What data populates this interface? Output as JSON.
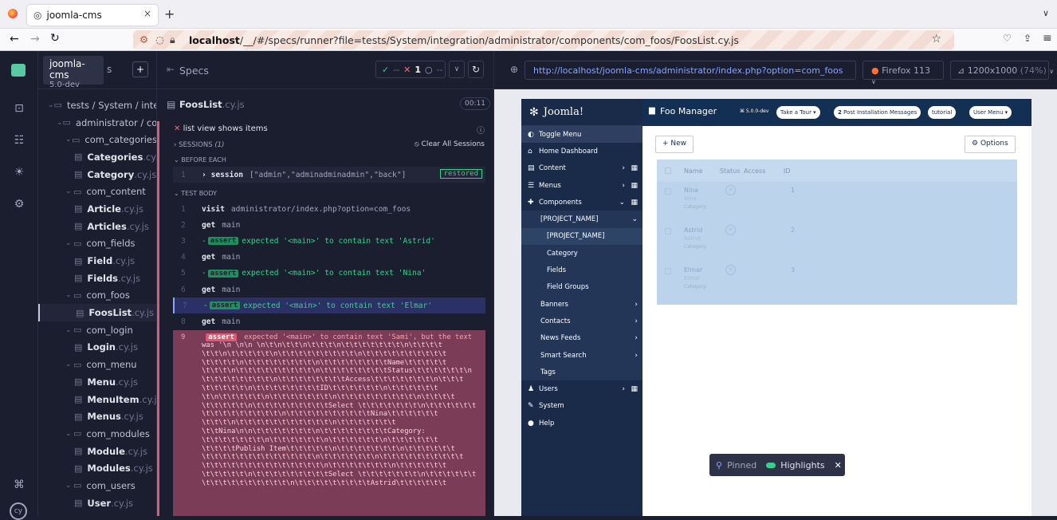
{
  "browser": {
    "tab_title": "joomla-cms",
    "tab_close": "×",
    "new_tab": "+",
    "url_host": "localhost",
    "url_path": "/__/#/specs/runner?file=tests/System/integration/administrator/components/com_foos/FoosList.cy.js"
  },
  "project": {
    "name": "joomla-cms",
    "version": "5.0-dev",
    "specs_suffix": "s"
  },
  "specs_panel": {
    "title": "Specs",
    "passed": "--",
    "failed": "1",
    "pending": "--",
    "tree": [
      {
        "type": "folder",
        "label": "tests / System / inte",
        "level": 0
      },
      {
        "type": "folder",
        "label": "administrator / co",
        "level": 1
      },
      {
        "type": "folder",
        "label": "com_categories",
        "level": 2
      },
      {
        "type": "file",
        "name": "Categories",
        "ext": ".cy.js",
        "level": 3
      },
      {
        "type": "file",
        "name": "Category",
        "ext": ".cy.js",
        "level": 3
      },
      {
        "type": "folder",
        "label": "com_content",
        "level": 2
      },
      {
        "type": "file",
        "name": "Article",
        "ext": ".cy.js",
        "level": 3
      },
      {
        "type": "file",
        "name": "Articles",
        "ext": ".cy.js",
        "level": 3
      },
      {
        "type": "folder",
        "label": "com_fields",
        "level": 2
      },
      {
        "type": "file",
        "name": "Field",
        "ext": ".cy.js",
        "level": 3
      },
      {
        "type": "file",
        "name": "Fields",
        "ext": ".cy.js",
        "level": 3
      },
      {
        "type": "folder",
        "label": "com_foos",
        "level": 2
      },
      {
        "type": "file",
        "name": "FoosList",
        "ext": ".cy.js",
        "level": 3,
        "selected": true
      },
      {
        "type": "folder",
        "label": "com_login",
        "level": 2
      },
      {
        "type": "file",
        "name": "Login",
        "ext": ".cy.js",
        "level": 3
      },
      {
        "type": "folder",
        "label": "com_menu",
        "level": 2
      },
      {
        "type": "file",
        "name": "Menu",
        "ext": ".cy.js",
        "level": 3
      },
      {
        "type": "file",
        "name": "MenuItem",
        "ext": ".cy.js",
        "level": 3
      },
      {
        "type": "file",
        "name": "Menus",
        "ext": ".cy.js",
        "level": 3
      },
      {
        "type": "folder",
        "label": "com_modules",
        "level": 2
      },
      {
        "type": "file",
        "name": "Module",
        "ext": ".cy.js",
        "level": 3
      },
      {
        "type": "file",
        "name": "Modules",
        "ext": ".cy.js",
        "level": 3
      },
      {
        "type": "folder",
        "label": "com_users",
        "level": 2
      },
      {
        "type": "file",
        "name": "User",
        "ext": ".cy.js",
        "level": 3
      },
      {
        "type": "file",
        "name": "Users",
        "ext": ".cy.js",
        "level": 3
      }
    ]
  },
  "reporter": {
    "file_name": "FoosList",
    "file_ext": ".cy.js",
    "duration": "00:11",
    "test_title": "list view shows items",
    "sessions_label": "SESSIONS",
    "sessions_count": "(1)",
    "clear_sessions": "Clear All Sessions",
    "before_each": "BEFORE EACH",
    "test_body": "TEST BODY",
    "session_cmd": {
      "num": "1",
      "name": "session",
      "msg": "[\"admin\",\"adminadminadmin\",\"back\"]",
      "status": "restored"
    },
    "commands": [
      {
        "num": "1",
        "name": "visit",
        "msg": "administrator/index.php?option=com_foos"
      },
      {
        "num": "2",
        "name": "get",
        "msg": "main"
      },
      {
        "num": "3",
        "assert": "assert",
        "msg": "expected '<main>' to contain text 'Astrid'"
      },
      {
        "num": "4",
        "name": "get",
        "msg": "main"
      },
      {
        "num": "5",
        "assert": "assert",
        "msg": "expected '<main>' to contain text 'Nina'"
      },
      {
        "num": "6",
        "name": "get",
        "msg": "main"
      },
      {
        "num": "7",
        "assert": "assert",
        "msg": "expected '<main>' to contain text 'Elmar'",
        "pinned": true
      },
      {
        "num": "8",
        "name": "get",
        "msg": "main"
      }
    ],
    "failed": {
      "num": "9",
      "assert": "assert",
      "lines": [
        "expected '<main>' to contain text 'Sami', but the text",
        "was '\\n \\n\\n \\n\\t\\n\\t\\t\\n\\t\\t\\t\\n\\t\\t\\t\\t\\t\\t\\t\\n\\t\\t\\t\\t",
        "\\t\\t\\n\\t\\t\\t\\t\\t\\n\\t\\t\\t\\t\\t\\t\\t\\t\\t\\n\\t\\t\\t\\t\\t\\t\\t\\t\\t\\t",
        "\\t\\t\\t\\t\\n\\t\\t\\t\\t\\t\\t\\t\\t\\n\\t\\t\\t\\t\\t\\t\\t\\tName\\t\\t\\t\\t\\t",
        "\\t\\t\\t\\n\\t\\t\\t\\t\\t\\t\\t\\t\\t\\n\\t\\t\\t\\t\\t\\t\\t\\tStatus\\t\\t\\t\\t\\t\\t\\n",
        "\\t\\t\\t\\t\\t\\t\\t\\t\\n\\t\\t\\t\\t\\t\\t\\t\\tAccess\\t\\t\\t\\t\\t\\t\\t\\n\\t\\t\\t",
        "\\t\\t\\t\\t\\t\\n\\t\\t\\t\\t\\t\\t\\t\\tID\\t\\t\\t\\t\\t\\t\\n\\t\\t\\t\\t\\t\\t",
        "\\t\\n\\t\\t\\t\\t\\t\\n\\t\\t\\t\\t\\t\\t\\t\\n\\t\\t\\t\\t\\t\\t\\t\\t\\t\\n\\t\\t\\t\\t",
        "\\t\\t\\t\\t\\t\\n\\t\\t\\t\\t\\t\\t\\t\\t\\tSelect \\t\\t\\t\\t\\t\\t\\t\\n\\t\\t\\t\\t\\t\\t",
        "\\t\\t\\t\\t\\t\\t\\t\\t\\t\\n\\t\\t\\t\\t\\t\\t\\t\\t\\t\\tNina\\t\\t\\t\\t\\t\\t",
        "\\t\\t\\t\\n\\t\\t\\t\\t\\t\\t\\t\\t\\t\\t\\t\\n\\t\\t\\t\\t\\t\\t\\t",
        "\\t\\tNina\\n\\n\\t\\t\\t\\t\\t\\t\\t\\n\\t\\t\\t\\t\\t\\t\\t\\tCategory:",
        "\\t\\t\\t\\t\\t\\t\\t\\n\\t\\t\\t\\t\\t\\t\\n\\t\\t\\t\\t\\t\\t\\n\\t\\t\\t\\t\\t\\t",
        "\\t\\t\\t\\tPublish Item\\t\\t\\t\\t\\t\\n\\t\\t\\t\\t\\t\\t\\t\\n\\t\\t\\t\\t\\t\\t",
        "\\t\\t\\t\\t\\t\\t\\t\\t\\t\\t\\t\\t\\t\\n\\t\\t\\t\\t\\t\\t\\n\\t\\t\\t\\t\\t\\t\\t\\t\\t\\t",
        "\\t\\t\\t\\t\\t\\t\\t\\t\\t\\t\\t\\t\\t\\t\\n\\t\\t\\t\\t\\t\\t\\t\\n\\t\\t\\t\\t\\t\\t",
        "\\t\\t\\t\\t\\t\\n\\t\\t\\t\\t\\t\\t\\t\\t\\tSelect \\t\\t\\t\\t\\t\\t\\t\\n\\t\\t\\t\\t\\t\\t",
        "\\t\\t\\t\\t\\t\\t\\t\\t\\t\\t\\n\\t\\t\\t\\t\\t\\t\\t\\t\\tAstrid\\t\\t\\t\\t\\t\\t"
      ]
    }
  },
  "aut": {
    "url": "http://localhost/joomla-cms/administrator/index.php?option=com_foos",
    "browser": "Firefox 113",
    "viewport": "1200x1000",
    "scale": "(74%)"
  },
  "joomla": {
    "brand": "Joomla!",
    "page_title": "Foo Manager",
    "version": "5.0.0-dev",
    "take_tour": "Take a Tour",
    "notifications_count": "2",
    "post_install": "Post Installation Messages",
    "tutorial": "tutorial",
    "user_menu": "User Menu",
    "new_button": "New",
    "options_button": "Options",
    "menu": [
      {
        "label": "Toggle Menu",
        "icon": "toggle-icon",
        "highlight": true
      },
      {
        "label": "Home Dashboard",
        "icon": "home-icon"
      },
      {
        "label": "Content",
        "icon": "file-icon",
        "arrow": true,
        "grid": true
      },
      {
        "label": "Menus",
        "icon": "list-icon",
        "arrow": true,
        "grid": true
      },
      {
        "label": "Components",
        "icon": "puzzle-icon",
        "arrow": "down",
        "grid": true
      },
      {
        "label": "[PROJECT_NAME]",
        "sub": 1,
        "arrow": "down"
      },
      {
        "label": "[PROJECT_NAME]",
        "sub": 2,
        "active": true
      },
      {
        "label": "Category",
        "sub": 2
      },
      {
        "label": "Fields",
        "sub": 2
      },
      {
        "label": "Field Groups",
        "sub": 2
      },
      {
        "label": "Banners",
        "sub": 1,
        "arrow": true
      },
      {
        "label": "Contacts",
        "sub": 1,
        "arrow": true
      },
      {
        "label": "News Feeds",
        "sub": 1,
        "arrow": true
      },
      {
        "label": "Smart Search",
        "sub": 1,
        "arrow": true
      },
      {
        "label": "Tags",
        "sub": 1
      },
      {
        "label": "Users",
        "icon": "users-icon",
        "arrow": true,
        "grid": true
      },
      {
        "label": "System",
        "icon": "wrench-icon"
      },
      {
        "label": "Help",
        "icon": "info-icon"
      }
    ],
    "table_headers": [
      "Name",
      "Status",
      "Access",
      "ID"
    ],
    "rows": [
      {
        "name": "Nina",
        "alias": "Nina",
        "category": "Category:",
        "id": "1"
      },
      {
        "name": "Astrid",
        "alias": "Astrid",
        "category": "Category:",
        "id": "2"
      },
      {
        "name": "Elmar",
        "alias": "Elmar",
        "category": "Category:",
        "id": "3"
      }
    ]
  },
  "pinned_bar": {
    "pinned": "Pinned",
    "highlights": "Highlights",
    "close": "✕"
  }
}
